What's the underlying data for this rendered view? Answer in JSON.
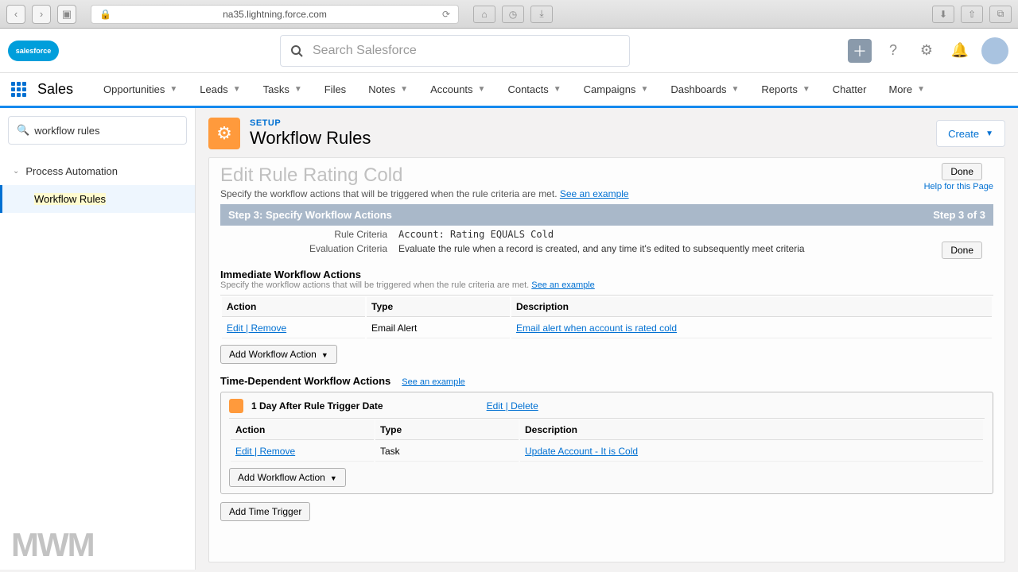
{
  "browser": {
    "url": "na35.lightning.force.com"
  },
  "header": {
    "search_placeholder": "Search Salesforce"
  },
  "nav": {
    "app": "Sales",
    "items": [
      "Opportunities",
      "Leads",
      "Tasks",
      "Files",
      "Notes",
      "Accounts",
      "Contacts",
      "Campaigns",
      "Dashboards",
      "Reports",
      "Chatter",
      "More"
    ]
  },
  "sidebar": {
    "search_value": "workflow rules",
    "parent": "Process Automation",
    "leaf": "Workflow Rules"
  },
  "setup": {
    "eyebrow": "SETUP",
    "title": "Workflow Rules",
    "create": "Create"
  },
  "page": {
    "title": "Edit Rule Rating Cold",
    "subtext": "Specify the workflow actions that will be triggered when the rule criteria are met. ",
    "see_example": "See an example",
    "done": "Done",
    "help": "Help for this Page",
    "step_left": "Step 3: Specify Workflow Actions",
    "step_right": "Step 3 of 3",
    "rule_criteria_lbl": "Rule Criteria",
    "rule_criteria_val": "Account: Rating EQUALS Cold",
    "eval_lbl": "Evaluation Criteria",
    "eval_val": "Evaluate the rule when a record is created, and any time it's edited to subsequently meet criteria",
    "immediate_hdr": "Immediate Workflow Actions",
    "immediate_sub": "Specify the workflow actions that will be triggered when the rule criteria are met. ",
    "cols": {
      "action": "Action",
      "type": "Type",
      "desc": "Description"
    },
    "immediate_row": {
      "action": "Edit | Remove",
      "type": "Email Alert",
      "desc": "Email alert when account is rated cold"
    },
    "add_action": "Add Workflow Action",
    "time_hdr": "Time-Dependent Workflow Actions",
    "trigger_title": "1 Day After Rule Trigger Date",
    "trigger_links": "Edit | Delete",
    "trigger_row": {
      "action": "Edit | Remove",
      "type": "Task",
      "desc": "Update Account - It is Cold"
    },
    "add_trigger": "Add Time Trigger"
  },
  "watermark": "MWM"
}
